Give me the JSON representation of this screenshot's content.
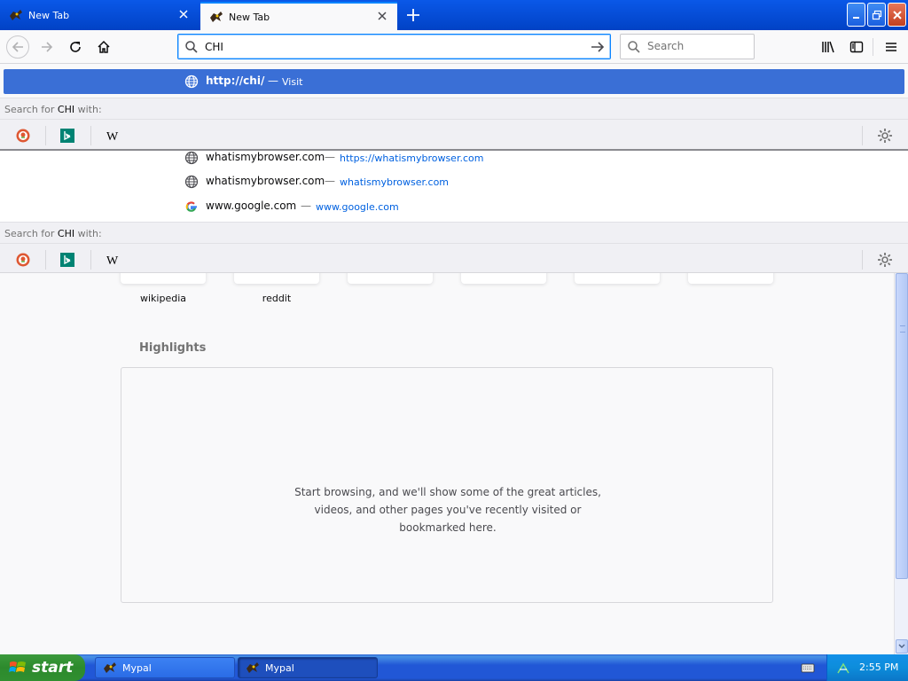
{
  "tabs": [
    {
      "title": "New Tab",
      "active": false
    },
    {
      "title": "New Tab",
      "active": true
    }
  ],
  "nav": {
    "url_value": "CHI",
    "search_placeholder": "Search"
  },
  "dropdown": {
    "selected": {
      "url": "http://chi/",
      "dash": "—",
      "action": "Visit"
    },
    "search_for_prefix": "Search for ",
    "search_for_term": "CHI",
    "search_for_suffix": " with:",
    "engines": [
      "DuckDuckGo",
      "Bing",
      "Wikipedia"
    ],
    "history": [
      {
        "title": "whatismybrowser.com",
        "dash": "—",
        "url": "https://whatismybrowser.com",
        "icon": "globe-icon"
      },
      {
        "title": "whatismybrowser.com",
        "dash": "—",
        "url": "whatismybrowser.com",
        "icon": "globe-icon"
      },
      {
        "title": "www.google.com",
        "dash": "—",
        "url": "www.google.com",
        "icon": "google-icon"
      }
    ]
  },
  "page": {
    "top_sites": [
      {
        "label": "wikipedia"
      },
      {
        "label": "reddit"
      },
      {
        "label": ""
      },
      {
        "label": ""
      },
      {
        "label": ""
      },
      {
        "label": ""
      }
    ],
    "highlights_title": "Highlights",
    "highlights_message": "Start browsing, and we'll show some of the great articles, videos, and other pages you've recently visited or bookmarked here."
  },
  "taskbar": {
    "start_label": "start",
    "tasks": [
      {
        "label": "Mypal"
      },
      {
        "label": "Mypal"
      }
    ],
    "clock": "2:55 PM"
  },
  "colors": {
    "accent": "#0a84ff",
    "selected_row": "#3a6fd6",
    "taskbar": "#2157d6",
    "start_green": "#3c9a3c"
  }
}
